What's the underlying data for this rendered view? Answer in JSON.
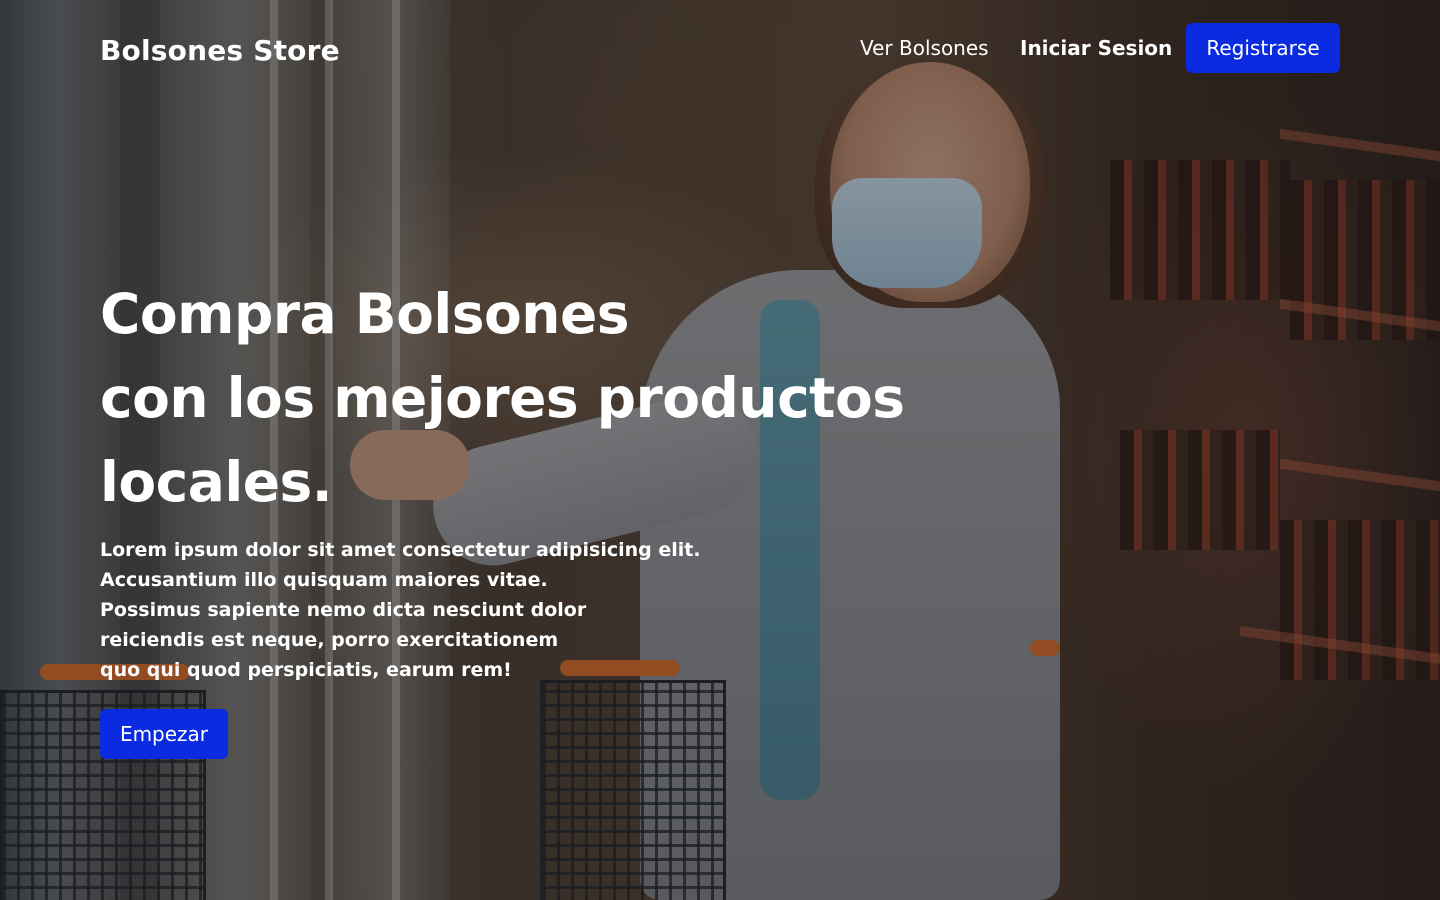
{
  "brand": {
    "name": "Bolsones Store"
  },
  "nav": {
    "ver_bolsones": "Ver Bolsones",
    "iniciar_sesion": "Iniciar Sesion",
    "registrarse": "Registrarse"
  },
  "hero": {
    "title_lines": [
      "Compra Bolsones",
      "con los mejores productos",
      "locales."
    ],
    "text_lines": [
      "Lorem ipsum dolor sit amet consectetur adipisicing elit.",
      "Accusantium illo quisquam maiores vitae.",
      "Possimus sapiente nemo dicta nesciunt dolor",
      "reiciendis est neque, porro exercitationem",
      "quo qui quod perspiciatis, earum rem!"
    ],
    "cta_label": "Empezar",
    "background_image": "supermarket-shopper-photo"
  },
  "colors": {
    "primary": "#0a2be0",
    "text": "#ffffff"
  }
}
